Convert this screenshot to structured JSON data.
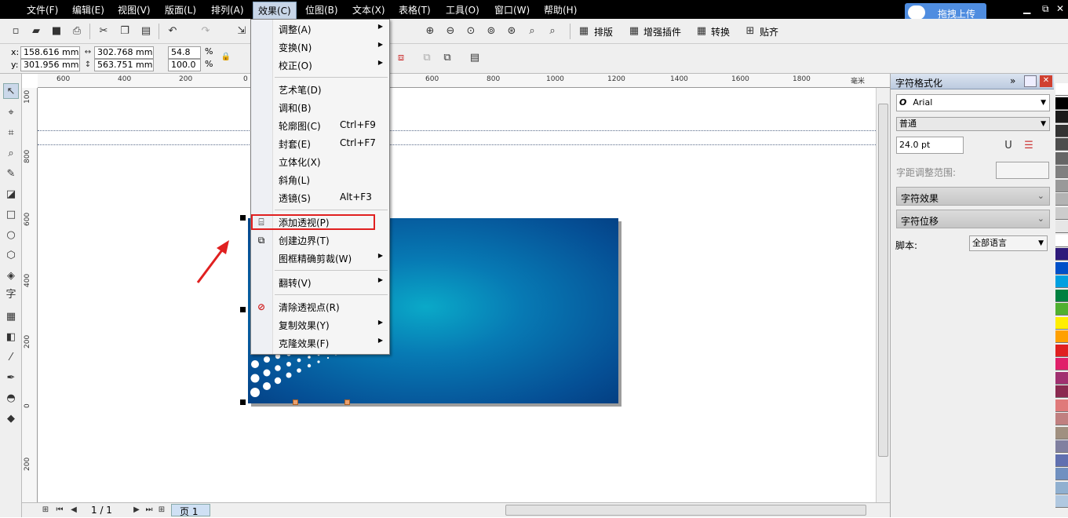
{
  "menubar": {
    "items": [
      "文件(F)",
      "编辑(E)",
      "视图(V)",
      "版面(L)",
      "排列(A)",
      "效果(C)",
      "位图(B)",
      "文本(X)",
      "表格(T)",
      "工具(O)",
      "窗口(W)",
      "帮助(H)"
    ],
    "upload_label": "拖拽上传"
  },
  "toolbar1": {
    "labels": [
      "排版",
      "增强插件",
      "转换",
      "贴齐"
    ]
  },
  "propbar": {
    "x_label": "x:",
    "x_value": "158.616 mm",
    "y_label": "y:",
    "y_value": "301.956 mm",
    "w_value": "302.768 mm",
    "h_value": "563.751 mm",
    "scale_w": "54.8",
    "scale_h": "100.0",
    "pct": "%"
  },
  "hruler": {
    "ticks": [
      "600",
      "400",
      "200",
      "0",
      "600",
      "800",
      "1000",
      "1200",
      "1400",
      "1600",
      "1800"
    ],
    "unit": "毫米"
  },
  "vruler": {
    "ticks": [
      "100",
      "800",
      "600",
      "400",
      "200",
      "0",
      "200"
    ]
  },
  "effects_menu": {
    "items": [
      {
        "label": "调整(A)",
        "submenu": true
      },
      {
        "label": "变换(N)",
        "submenu": true
      },
      {
        "label": "校正(O)",
        "submenu": true
      },
      {
        "label": "艺术笔(D)"
      },
      {
        "label": "调和(B)"
      },
      {
        "label": "轮廓图(C)",
        "shortcut": "Ctrl+F9"
      },
      {
        "label": "封套(E)",
        "shortcut": "Ctrl+F7"
      },
      {
        "label": "立体化(X)"
      },
      {
        "label": "斜角(L)"
      },
      {
        "label": "透镜(S)",
        "shortcut": "Alt+F3"
      },
      {
        "label": "添加透视(P)",
        "icon": "perspective-icon",
        "highlighted": true
      },
      {
        "label": "创建边界(T)",
        "icon": "boundary-icon"
      },
      {
        "label": "图框精确剪裁(W)",
        "submenu": true
      },
      {
        "label": "翻转(V)",
        "submenu": true
      },
      {
        "label": "清除透视点(R)",
        "icon": "clear-perspective-icon"
      },
      {
        "label": "复制效果(Y)",
        "submenu": true
      },
      {
        "label": "克隆效果(F)",
        "submenu": true
      }
    ]
  },
  "docker": {
    "title": "字符格式化",
    "font": "Arial",
    "style": "普通",
    "size": "24.0 pt",
    "kerning_label": "字距调整范围:",
    "section_effects": "字符效果",
    "section_shift": "字符位移",
    "script_label": "脚本:",
    "script_value": "全部语言"
  },
  "statusbar": {
    "page_count": "1 / 1",
    "page_tab": "页 1"
  },
  "palette_colors": [
    "#ffffff",
    "#000000",
    "#1a1a1a",
    "#333333",
    "#4d4d4d",
    "#666666",
    "#808080",
    "#999999",
    "#b3b3b3",
    "#cccccc",
    "#e6e6e6",
    "#ffffff",
    "#2e1a7a",
    "#0050c8",
    "#00a0e0",
    "#008040",
    "#50b030",
    "#ffee00",
    "#ffa000",
    "#e02020",
    "#e0206a",
    "#a03070",
    "#8a2a50",
    "#e07a7a",
    "#c08080",
    "#a09080",
    "#8080a0",
    "#6070b0",
    "#7090c0",
    "#90b0d0",
    "#b0c8e0"
  ]
}
